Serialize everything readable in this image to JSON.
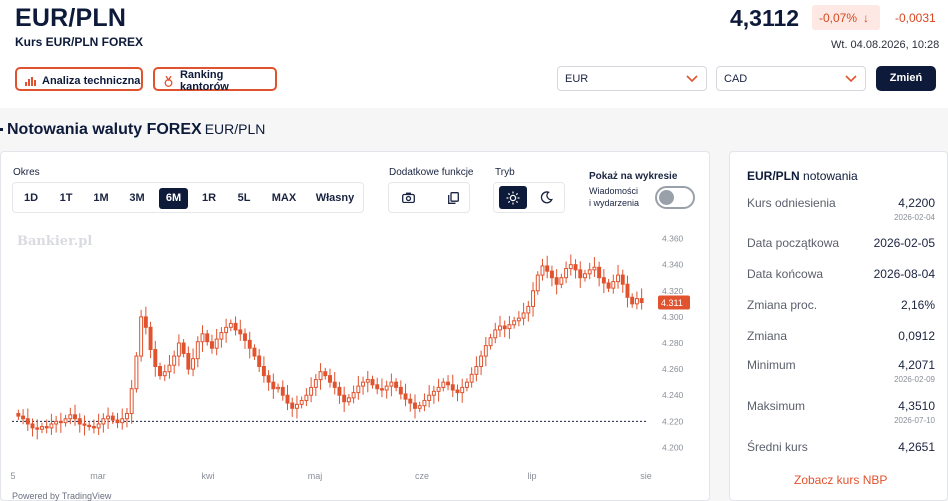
{
  "header": {
    "title": "EUR/PLN",
    "subtitle": "Kurs EUR/PLN FOREX",
    "price": "4,3112",
    "change_pct": "-0,07%",
    "change_abs": "-0,0031",
    "updated": "Wt. 04.08.2026, 10:28",
    "btn_analysis": "Analiza techniczna",
    "btn_ranking": "Ranking kantorów",
    "select_from": "EUR",
    "select_to": "CAD",
    "btn_change": "Zmień"
  },
  "section": {
    "title": "Notowania waluty FOREX",
    "pair": "EUR/PLN"
  },
  "controls": {
    "period_label": "Okres",
    "periods": [
      "1D",
      "1T",
      "1M",
      "3M",
      "6M",
      "1R",
      "5L",
      "MAX",
      "Własny"
    ],
    "active_period": "6M",
    "functions_label": "Dodatkowe funkcje",
    "mode_label": "Tryb",
    "show_label": "Pokaż na wykresie",
    "news_label_1": "Wiadomości",
    "news_label_2": "i wydarzenia",
    "news_toggle": false
  },
  "chart_data": {
    "type": "candlestick",
    "watermark": "Bankier.pl",
    "powered_by": "Powered by TradingView",
    "y_ticks": [
      "4.360",
      "4.340",
      "4.320",
      "4.300",
      "4.280",
      "4.260",
      "4.240",
      "4.220",
      "4.200"
    ],
    "ylim": [
      4.195,
      4.365
    ],
    "x_ticks": [
      "5",
      "mar",
      "kwi",
      "maj",
      "cze",
      "lip",
      "sie"
    ],
    "last_price_label": "4.311",
    "last_price": 4.311,
    "reference_line": 4.22,
    "closes": [
      4.224,
      4.222,
      4.218,
      4.215,
      4.214,
      4.216,
      4.215,
      4.218,
      4.22,
      4.219,
      4.222,
      4.225,
      4.222,
      4.218,
      4.217,
      4.216,
      4.215,
      4.218,
      4.222,
      4.224,
      4.221,
      4.219,
      4.222,
      4.226,
      4.245,
      4.27,
      4.3,
      4.292,
      4.275,
      4.262,
      4.255,
      4.258,
      4.263,
      4.27,
      4.28,
      4.272,
      4.26,
      4.268,
      4.281,
      4.287,
      4.281,
      4.276,
      4.283,
      4.288,
      4.292,
      4.295,
      4.29,
      4.287,
      4.282,
      4.276,
      4.27,
      4.262,
      4.255,
      4.25,
      4.245,
      4.246,
      4.24,
      4.234,
      4.23,
      4.233,
      4.236,
      4.24,
      4.246,
      4.252,
      4.258,
      4.255,
      4.25,
      4.246,
      4.24,
      4.235,
      4.238,
      4.242,
      4.247,
      4.25,
      4.252,
      4.248,
      4.245,
      4.244,
      4.247,
      4.25,
      4.246,
      4.241,
      4.237,
      4.234,
      4.23,
      4.232,
      4.236,
      4.24,
      4.243,
      4.246,
      4.25,
      4.248,
      4.244,
      4.242,
      4.246,
      4.25,
      4.256,
      4.262,
      4.27,
      4.278,
      4.284,
      4.29,
      4.293,
      4.291,
      4.294,
      4.297,
      4.299,
      4.303,
      4.308,
      4.32,
      4.332,
      4.339,
      4.335,
      4.33,
      4.325,
      4.33,
      4.337,
      4.34,
      4.336,
      4.33,
      4.333,
      4.336,
      4.338,
      4.33,
      4.326,
      4.322,
      4.327,
      4.332,
      4.325,
      4.315,
      4.31,
      4.314,
      4.311
    ],
    "period": "2026-02-04 – 2026-08-04"
  },
  "sidebar": {
    "pair": "EUR/PLN",
    "suffix": "notowania",
    "rows": [
      {
        "label": "Kurs odniesienia",
        "value": "4,2200",
        "date": "2026-02-04"
      },
      {
        "label": "Data początkowa",
        "value": "2026-02-05",
        "date": ""
      },
      {
        "label": "Data końcowa",
        "value": "2026-08-04",
        "date": ""
      },
      {
        "label": "Zmiana proc.",
        "value": "2,16%",
        "date": ""
      },
      {
        "label": "Zmiana",
        "value": "0,0912",
        "date": ""
      },
      {
        "label": "Minimum",
        "value": "4,2071",
        "date": "2026-02-09"
      },
      {
        "label": "Maksimum",
        "value": "4,3510",
        "date": "2026-07-10"
      },
      {
        "label": "Średni kurs",
        "value": "4,2651",
        "date": ""
      }
    ],
    "link": "Zobacz kurs NBP"
  },
  "colors": {
    "accent": "#e0532e",
    "navy": "#0d1a3a",
    "down": "#d9471f"
  }
}
